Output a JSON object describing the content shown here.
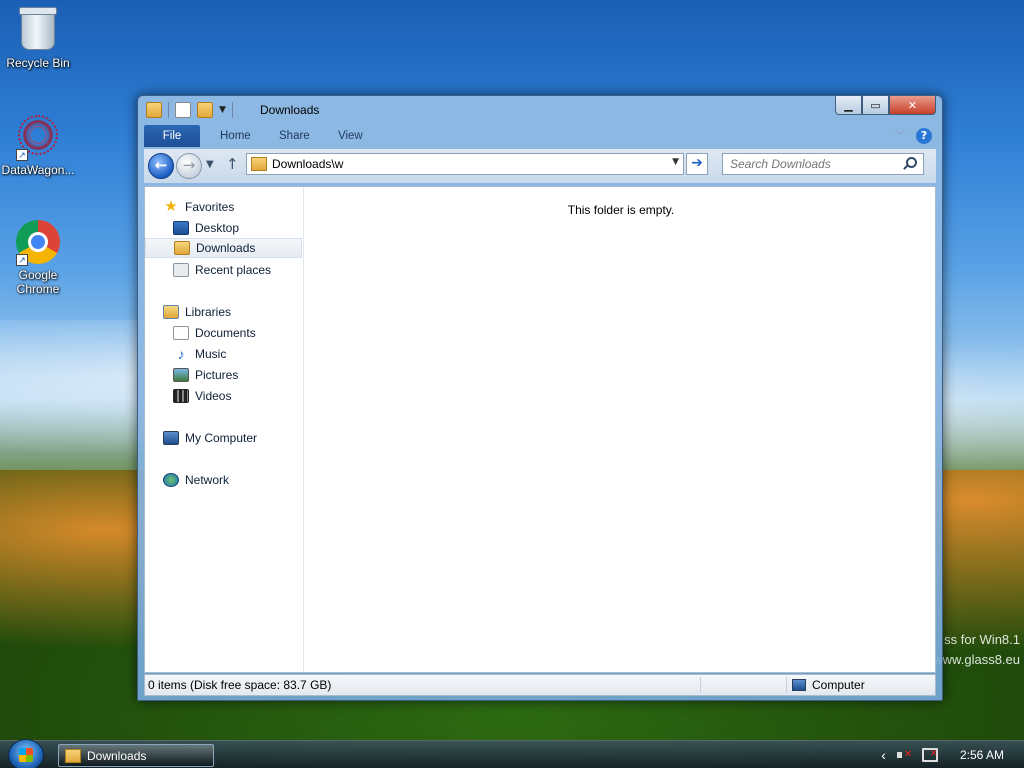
{
  "desktop": {
    "icons": [
      {
        "label": "Recycle Bin"
      },
      {
        "label": "DataWagon..."
      },
      {
        "label": "Google Chrome"
      }
    ],
    "watermark_line1": "ss for Win8.1",
    "watermark_line2": "www.glass8.eu"
  },
  "window": {
    "title": "Downloads",
    "ribbon_tabs": [
      "File",
      "Home",
      "Share",
      "View"
    ],
    "address_value": "Downloads\\w",
    "search_placeholder": "Search Downloads",
    "nav_pane": {
      "favorites_label": "Favorites",
      "favorites": [
        "Desktop",
        "Downloads",
        "Recent places"
      ],
      "libraries_label": "Libraries",
      "libraries": [
        "Documents",
        "Music",
        "Pictures",
        "Videos"
      ],
      "computer_label": "My Computer",
      "network_label": "Network"
    },
    "empty_message": "This folder is empty.",
    "status_left": "0 items (Disk free space: 83.7 GB)",
    "status_right": "Computer"
  },
  "taskbar": {
    "active_window": "Downloads",
    "clock": "2:56 AM"
  },
  "colors": {
    "accent": "#1c4f98",
    "selection": "#e6ecf2"
  }
}
